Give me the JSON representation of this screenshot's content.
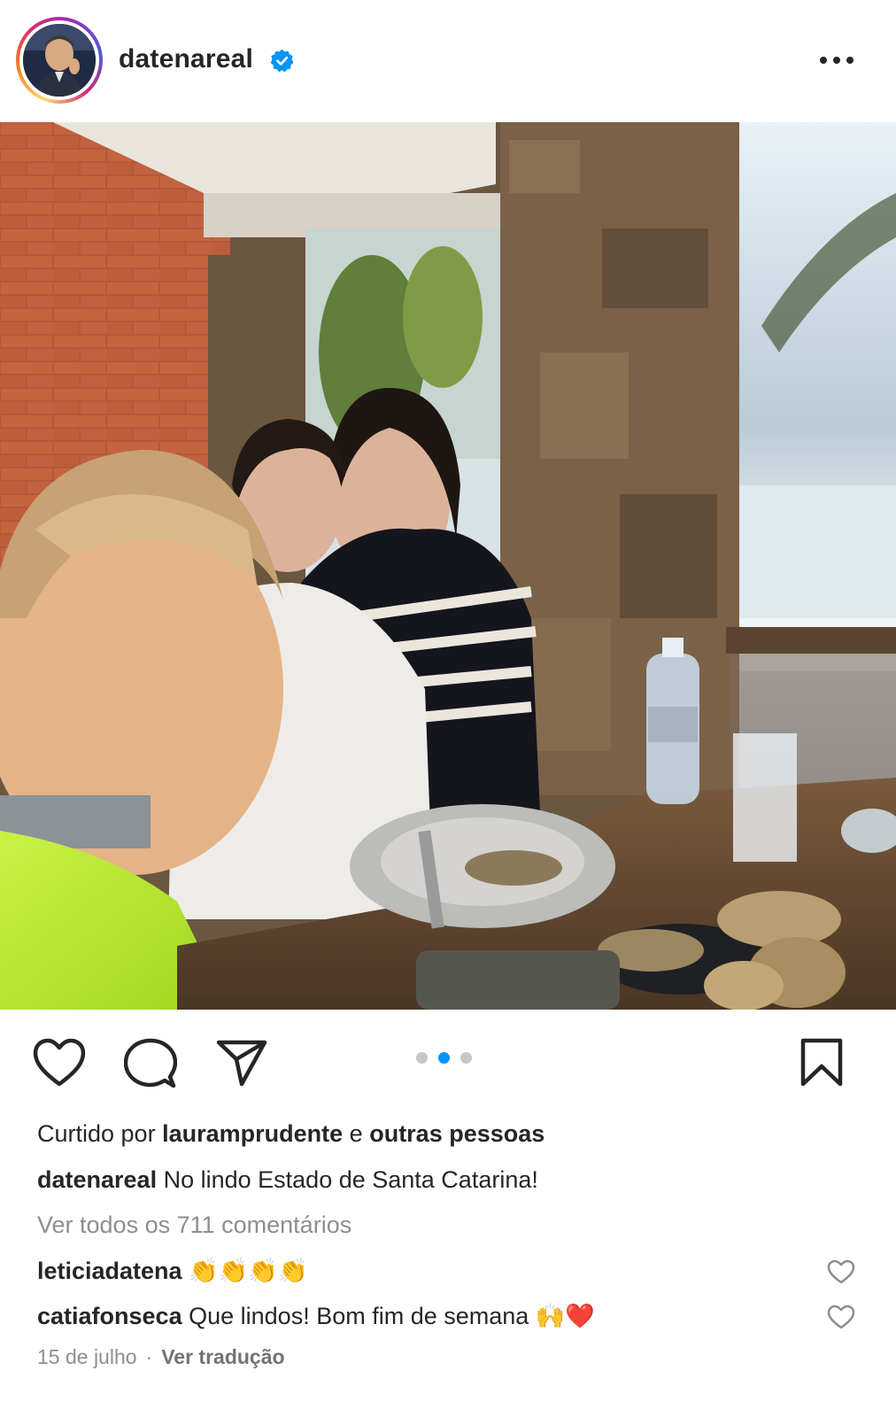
{
  "post": {
    "username": "datenareal",
    "verified": true,
    "more_icon": "more-horizontal-icon"
  },
  "actions": {
    "like_icon": "heart-outline-icon",
    "comment_icon": "comment-bubble-icon",
    "share_icon": "paper-plane-icon",
    "save_icon": "bookmark-outline-icon"
  },
  "carousel": {
    "count": 3,
    "active_index": 1
  },
  "likes": {
    "prefix": "Curtido por",
    "user": "lauramprudente",
    "conj": "e",
    "others": "outras pessoas"
  },
  "caption": {
    "user": "datenareal",
    "text": "No lindo Estado de Santa Catarina!"
  },
  "view_comments": "Ver todos os 711 comentários",
  "comments": [
    {
      "user": "leticiadatena",
      "text": "👏👏👏👏"
    },
    {
      "user": "catiafonseca",
      "text": "Que lindos! Bom fim de semana 🙌❤️"
    }
  ],
  "meta": {
    "date": "15 de julho",
    "separator": "·",
    "translate": "Ver tradução"
  },
  "colors": {
    "accent_blue": "#0095f6",
    "verified_blue": "#0095f6",
    "text": "#262626",
    "muted": "#8e8e8e"
  }
}
